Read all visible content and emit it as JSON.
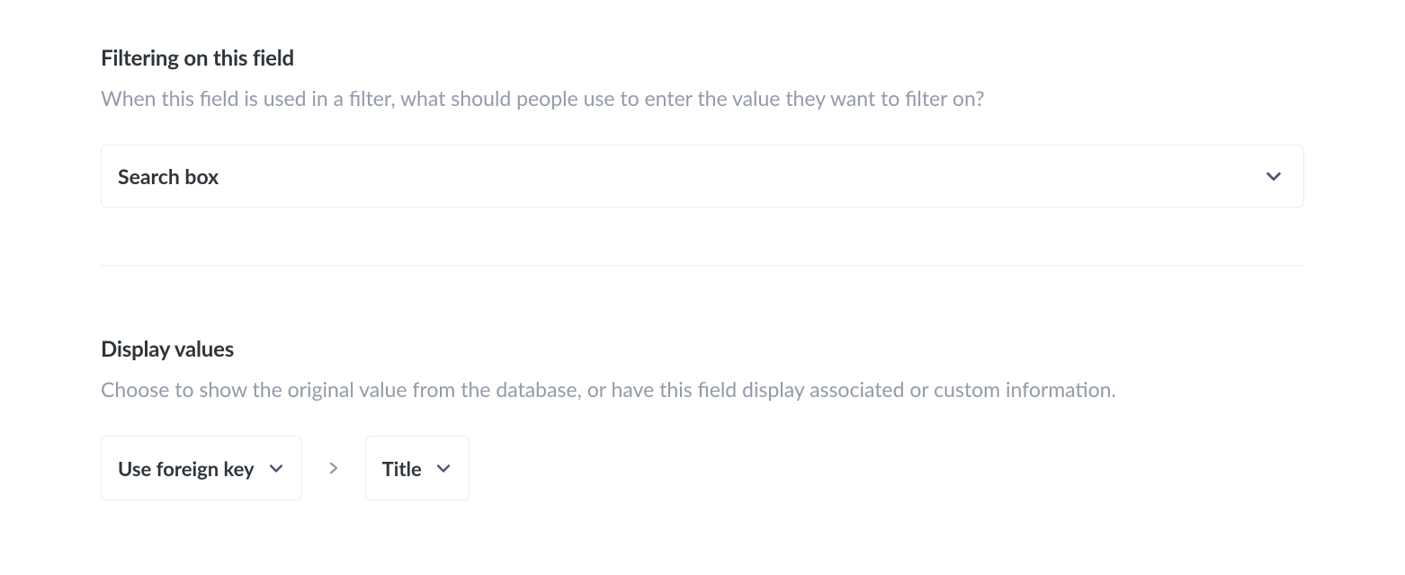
{
  "filtering": {
    "title": "Filtering on this field",
    "description": "When this field is used in a filter, what should people use to enter the value they want to filter on?",
    "value": "Search box"
  },
  "display_values": {
    "title": "Display values",
    "description": "Choose to show the original value from the database, or have this field display associated or custom information.",
    "first_value": "Use foreign key",
    "second_value": "Title"
  }
}
